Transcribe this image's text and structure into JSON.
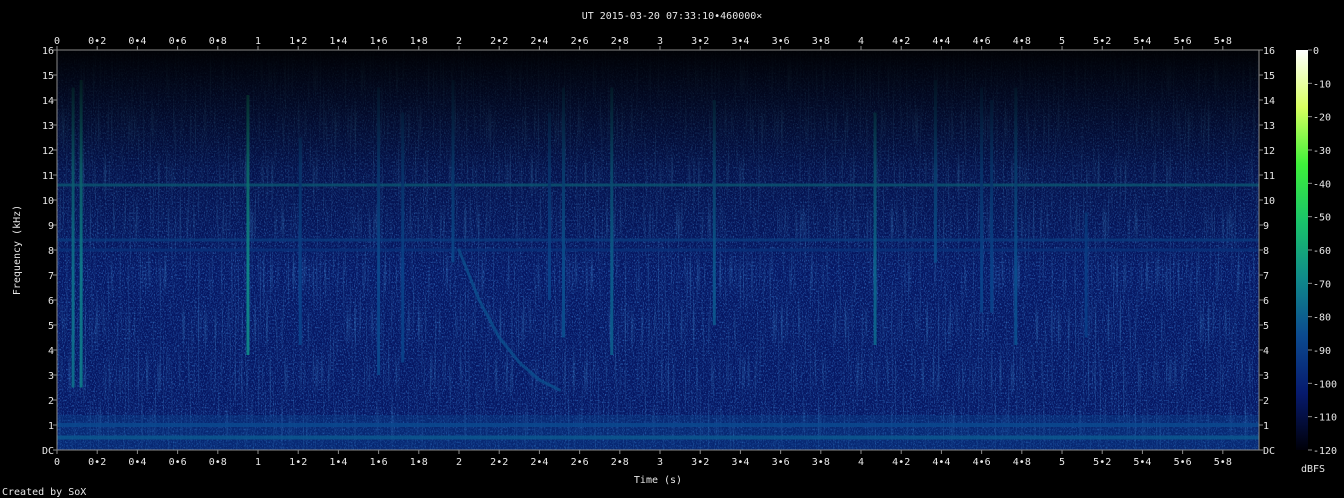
{
  "chart_data": {
    "type": "heatmap",
    "title": "UT 2015-03-20 07:33:10•460000×",
    "xlabel": "Time (s)",
    "ylabel": "Frequency (kHz)",
    "xlim": [
      0,
      5.98
    ],
    "ylim": [
      0,
      16
    ],
    "x_ticks": [
      {
        "v": 0,
        "t": "0"
      },
      {
        "v": 0.2,
        "t": "0•2"
      },
      {
        "v": 0.4,
        "t": "0•4"
      },
      {
        "v": 0.6,
        "t": "0•6"
      },
      {
        "v": 0.8,
        "t": "0•8"
      },
      {
        "v": 1,
        "t": "1"
      },
      {
        "v": 1.2,
        "t": "1•2"
      },
      {
        "v": 1.4,
        "t": "1•4"
      },
      {
        "v": 1.6,
        "t": "1•6"
      },
      {
        "v": 1.8,
        "t": "1•8"
      },
      {
        "v": 2,
        "t": "2"
      },
      {
        "v": 2.2,
        "t": "2•2"
      },
      {
        "v": 2.4,
        "t": "2•4"
      },
      {
        "v": 2.6,
        "t": "2•6"
      },
      {
        "v": 2.8,
        "t": "2•8"
      },
      {
        "v": 3,
        "t": "3"
      },
      {
        "v": 3.2,
        "t": "3•2"
      },
      {
        "v": 3.4,
        "t": "3•4"
      },
      {
        "v": 3.6,
        "t": "3•6"
      },
      {
        "v": 3.8,
        "t": "3•8"
      },
      {
        "v": 4,
        "t": "4"
      },
      {
        "v": 4.2,
        "t": "4•2"
      },
      {
        "v": 4.4,
        "t": "4•4"
      },
      {
        "v": 4.6,
        "t": "4•6"
      },
      {
        "v": 4.8,
        "t": "4•8"
      },
      {
        "v": 5,
        "t": "5"
      },
      {
        "v": 5.2,
        "t": "5•2"
      },
      {
        "v": 5.4,
        "t": "5•4"
      },
      {
        "v": 5.6,
        "t": "5•6"
      },
      {
        "v": 5.8,
        "t": "5•8"
      }
    ],
    "y_ticks": [
      {
        "v": 0,
        "t": "DC"
      },
      {
        "v": 1,
        "t": "1"
      },
      {
        "v": 2,
        "t": "2"
      },
      {
        "v": 3,
        "t": "3"
      },
      {
        "v": 4,
        "t": "4"
      },
      {
        "v": 5,
        "t": "5"
      },
      {
        "v": 6,
        "t": "6"
      },
      {
        "v": 7,
        "t": "7"
      },
      {
        "v": 8,
        "t": "8"
      },
      {
        "v": 9,
        "t": "9"
      },
      {
        "v": 10,
        "t": "10"
      },
      {
        "v": 11,
        "t": "11"
      },
      {
        "v": 12,
        "t": "12"
      },
      {
        "v": 13,
        "t": "13"
      },
      {
        "v": 14,
        "t": "14"
      },
      {
        "v": 15,
        "t": "15"
      },
      {
        "v": 16,
        "t": "16"
      }
    ],
    "colorbar": {
      "label": "dBFS",
      "range": [
        -120,
        0
      ],
      "ticks": [
        {
          "v": 0,
          "t": "0"
        },
        {
          "v": -10,
          "t": "-10"
        },
        {
          "v": -20,
          "t": "-20"
        },
        {
          "v": -30,
          "t": "-30"
        },
        {
          "v": -40,
          "t": "-40"
        },
        {
          "v": -50,
          "t": "-50"
        },
        {
          "v": -60,
          "t": "-60"
        },
        {
          "v": -70,
          "t": "-70"
        },
        {
          "v": -80,
          "t": "-80"
        },
        {
          "v": -90,
          "t": "-90"
        },
        {
          "v": -100,
          "t": "-100"
        },
        {
          "v": -110,
          "t": "-110"
        },
        {
          "v": -120,
          "t": "-120"
        }
      ],
      "colors": [
        "#000008",
        "#061a6e",
        "#0b4a8f",
        "#0f8a8a",
        "#19c46a",
        "#3ef03a",
        "#d8ff60",
        "#ffffff"
      ]
    },
    "background_level_dbfs": -102,
    "horizontal_lines": [
      {
        "freq_khz": 10.6,
        "level_dbfs": -78
      },
      {
        "freq_khz": 8.4,
        "level_dbfs": -90
      },
      {
        "freq_khz": 8.0,
        "level_dbfs": -94
      },
      {
        "freq_khz": 0.5,
        "level_dbfs": -80
      },
      {
        "freq_khz": 1.0,
        "level_dbfs": -86
      }
    ],
    "impulses": [
      {
        "t": 0.08,
        "f_low": 2.5,
        "f_high": 14.5,
        "level_dbfs": -75
      },
      {
        "t": 0.12,
        "f_low": 2.5,
        "f_high": 14.8,
        "level_dbfs": -72
      },
      {
        "t": 0.95,
        "f_low": 3.8,
        "f_high": 14.2,
        "level_dbfs": -68
      },
      {
        "t": 1.21,
        "f_low": 4.2,
        "f_high": 12.5,
        "level_dbfs": -88
      },
      {
        "t": 1.6,
        "f_low": 3.0,
        "f_high": 14.5,
        "level_dbfs": -86
      },
      {
        "t": 1.72,
        "f_low": 3.5,
        "f_high": 13.5,
        "level_dbfs": -88
      },
      {
        "t": 1.97,
        "f_low": 7.5,
        "f_high": 14.8,
        "level_dbfs": -86
      },
      {
        "t": 2.45,
        "f_low": 6.0,
        "f_high": 13.5,
        "level_dbfs": -88
      },
      {
        "t": 2.52,
        "f_low": 4.5,
        "f_high": 14.5,
        "level_dbfs": -84
      },
      {
        "t": 2.76,
        "f_low": 3.8,
        "f_high": 14.5,
        "level_dbfs": -80
      },
      {
        "t": 3.27,
        "f_low": 5.0,
        "f_high": 14.0,
        "level_dbfs": -82
      },
      {
        "t": 4.07,
        "f_low": 4.2,
        "f_high": 13.5,
        "level_dbfs": -78
      },
      {
        "t": 4.37,
        "f_low": 7.5,
        "f_high": 14.8,
        "level_dbfs": -84
      },
      {
        "t": 4.6,
        "f_low": 5.5,
        "f_high": 14.5,
        "level_dbfs": -88
      },
      {
        "t": 4.65,
        "f_low": 5.5,
        "f_high": 14.0,
        "level_dbfs": -88
      },
      {
        "t": 4.77,
        "f_low": 4.2,
        "f_high": 14.5,
        "level_dbfs": -84
      },
      {
        "t": 5.12,
        "f_low": 4.5,
        "f_high": 9.5,
        "level_dbfs": -90
      }
    ],
    "sweep": {
      "points": [
        [
          2.0,
          8.0
        ],
        [
          2.1,
          6.0
        ],
        [
          2.2,
          4.5
        ],
        [
          2.3,
          3.5
        ],
        [
          2.4,
          2.8
        ],
        [
          2.5,
          2.4
        ]
      ],
      "level_dbfs": -84
    },
    "grid": false
  },
  "footer": {
    "credit": "Created by SoX"
  }
}
